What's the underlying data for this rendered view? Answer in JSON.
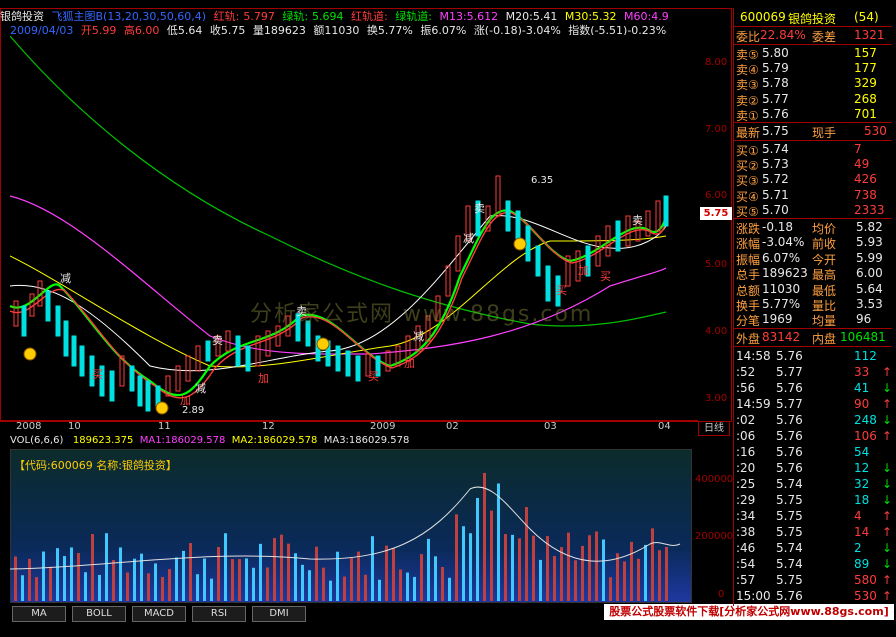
{
  "header": {
    "stock_name": "银鸽投资",
    "indicator": "飞狐主图B(13,20,30,50,60,4)",
    "red_track_label": "红轨:",
    "red_track": "5.797",
    "green_track_label": "绿轨:",
    "green_track": "5.694",
    "red_channel_label": "红轨道:",
    "green_channel_label": "绿轨道:",
    "m13": "M13:5.612",
    "m20": "M20:5.41",
    "m30": "M30:5.32",
    "m60": "M60:4.9"
  },
  "info_line": {
    "date": "2009/04/03",
    "open": "开5.99",
    "high": "高6.00",
    "low": "低5.64",
    "close": "收5.75",
    "volume": "量189623",
    "amount": "额11030",
    "turnover": "换5.77%",
    "amplitude": "振6.07%",
    "change": "涨(-0.18)-3.04%",
    "index": "指数(-5.51)-0.23%"
  },
  "price_axis": [
    "8.00",
    "7.00",
    "6.00",
    "5.00",
    "4.00",
    "3.00"
  ],
  "current_price_flag": "5.75",
  "time_axis": [
    "2008",
    "10",
    "11",
    "12",
    "2009",
    "02",
    "03",
    "04"
  ],
  "day_tab": "日线",
  "annotations": {
    "high": "6.35",
    "low": "2.89",
    "buy": "买",
    "sell": "卖",
    "reduce": "减",
    "add": "加"
  },
  "watermark": "分析家公式网  www.88gs.com",
  "volume_header": {
    "title": "VOL(6,6,6)",
    "vol": "189623.375",
    "ma1": "MA1:186029.578",
    "ma2": "MA2:186029.578",
    "ma3": "MA3:186029.578"
  },
  "code_line": "【代码:600069 名称:银鸽投资】",
  "volume_axis": [
    "400000",
    "200000",
    "0"
  ],
  "tabs": [
    "MA",
    "BOLL",
    "MACD",
    "RSI",
    "DMI"
  ],
  "footer_banner": "股票公式股票软件下载[分析家公式网www.88gs.com]",
  "quote": {
    "code": "600069",
    "name": "银鸽投资",
    "count": "(54)",
    "weibi_label": "委比",
    "weibi": "22.84%",
    "weicha_label": "委差",
    "weicha": "1321",
    "sell": [
      {
        "label": "卖⑤",
        "price": "5.80",
        "vol": "157"
      },
      {
        "label": "卖④",
        "price": "5.79",
        "vol": "177"
      },
      {
        "label": "卖③",
        "price": "5.78",
        "vol": "329"
      },
      {
        "label": "卖②",
        "price": "5.77",
        "vol": "268"
      },
      {
        "label": "卖①",
        "price": "5.76",
        "vol": "701"
      }
    ],
    "latest_label": "最新",
    "latest": "5.75",
    "now_label": "现手",
    "now": "530",
    "buy": [
      {
        "label": "买①",
        "price": "5.74",
        "vol": "7"
      },
      {
        "label": "买②",
        "price": "5.73",
        "vol": "49"
      },
      {
        "label": "买③",
        "price": "5.72",
        "vol": "426"
      },
      {
        "label": "买④",
        "price": "5.71",
        "vol": "738"
      },
      {
        "label": "买⑤",
        "price": "5.70",
        "vol": "2333"
      }
    ],
    "stats": [
      {
        "l1": "涨跌",
        "v1": "-0.18",
        "l2": "均价",
        "v2": "5.82"
      },
      {
        "l1": "涨幅",
        "v1": "-3.04%",
        "l2": "前收",
        "v2": "5.93"
      },
      {
        "l1": "振幅",
        "v1": "6.07%",
        "l2": "今开",
        "v2": "5.99"
      },
      {
        "l1": "总手",
        "v1": "189623",
        "l2": "最高",
        "v2": "6.00"
      },
      {
        "l1": "总额",
        "v1": "11030",
        "l2": "最低",
        "v2": "5.64"
      },
      {
        "l1": "换手",
        "v1": "5.77%",
        "l2": "量比",
        "v2": "3.53"
      },
      {
        "l1": "分笔",
        "v1": "1969",
        "l2": "均量",
        "v2": "96"
      }
    ],
    "outer_label": "外盘",
    "outer": "83142",
    "inner_label": "内盘",
    "inner": "106481"
  },
  "ticks": [
    {
      "t": "14:58",
      "p": "5.76",
      "v": "112",
      "d": ""
    },
    {
      "t": ":52",
      "p": "5.77",
      "v": "33",
      "d": "↑"
    },
    {
      "t": ":56",
      "p": "5.76",
      "v": "41",
      "d": "↓"
    },
    {
      "t": "14:59",
      "p": "5.77",
      "v": "90",
      "d": "↑"
    },
    {
      "t": ":02",
      "p": "5.76",
      "v": "248",
      "d": "↓"
    },
    {
      "t": ":06",
      "p": "5.76",
      "v": "106",
      "d": "↑"
    },
    {
      "t": ":16",
      "p": "5.76",
      "v": "54",
      "d": ""
    },
    {
      "t": ":20",
      "p": "5.76",
      "v": "12",
      "d": "↓"
    },
    {
      "t": ":25",
      "p": "5.74",
      "v": "32",
      "d": "↓"
    },
    {
      "t": ":29",
      "p": "5.75",
      "v": "18",
      "d": "↓"
    },
    {
      "t": ":34",
      "p": "5.75",
      "v": "4",
      "d": "↑"
    },
    {
      "t": ":38",
      "p": "5.75",
      "v": "14",
      "d": "↑"
    },
    {
      "t": ":46",
      "p": "5.74",
      "v": "2",
      "d": "↓"
    },
    {
      "t": ":54",
      "p": "5.74",
      "v": "89",
      "d": "↓"
    },
    {
      "t": ":57",
      "p": "5.75",
      "v": "580",
      "d": "↑"
    },
    {
      "t": "15:00",
      "p": "5.76",
      "v": "530",
      "d": "↑"
    }
  ],
  "colors": {
    "up": "#ff3c3c",
    "down": "#00e0e0",
    "ma5": "#ffffff",
    "ma10": "#ffff00",
    "ma20": "#ff40ff",
    "ma60": "#00ff00",
    "frame": "#a00000"
  }
}
